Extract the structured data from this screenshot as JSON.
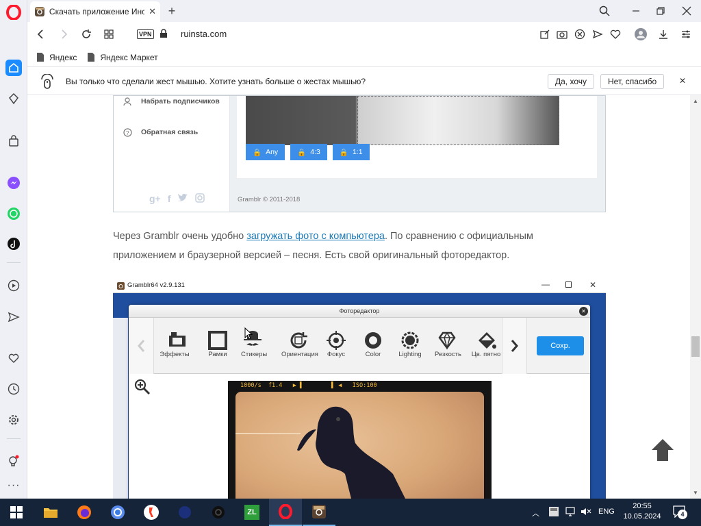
{
  "browser": {
    "tab_title": "Скачать приложение Инс",
    "url": "ruinsta.com",
    "vpn_label": "VPN",
    "bookmarks": [
      "Яндекс",
      "Яндекс Маркет"
    ]
  },
  "notification": {
    "text": "Вы только что сделали жест мышью. Хотите узнать больше о жестах мышью?",
    "yes_label": "Да, хочу",
    "no_label": "Нет, спасибо"
  },
  "screenshot1": {
    "menu_items": [
      "Набрать подписчиков",
      "Обратная связь"
    ],
    "crop_buttons": [
      "Any",
      "4:3",
      "1:1"
    ],
    "footer": "Gramblr © 2011-2018"
  },
  "article": {
    "text_before_link": "Через Gramblr очень удобно ",
    "link_text": "загружать фото с компьютера",
    "text_after_link": ". По сравнению с официальным",
    "line2": "приложением и браузерной версией – песня. Есть свой оригинальный фоторедактор."
  },
  "screenshot2": {
    "window_title": "Gramblr64 v2.9.131",
    "dialog_title": "Фоторедактор",
    "tools": [
      "Эффекты",
      "Рамки",
      "Стикеры",
      "Ориентация",
      "Фокус",
      "Color",
      "Lighting",
      "Резкость",
      "Цв. пятно"
    ],
    "save_label": "Сохр.",
    "film_top": "1000/s  f1.4   ▶ ▌        ▌ ◀   ISO:100"
  },
  "taskbar": {
    "language": "ENG",
    "time": "20:55",
    "date": "10.05.2024",
    "notification_count": "4"
  },
  "colors": {
    "opera_red": "#ff1b2d",
    "link": "#1a7ab8",
    "gramblr_blue": "#1f4e9e",
    "save_button": "#1e8fe8",
    "taskbar": "#16243a"
  }
}
